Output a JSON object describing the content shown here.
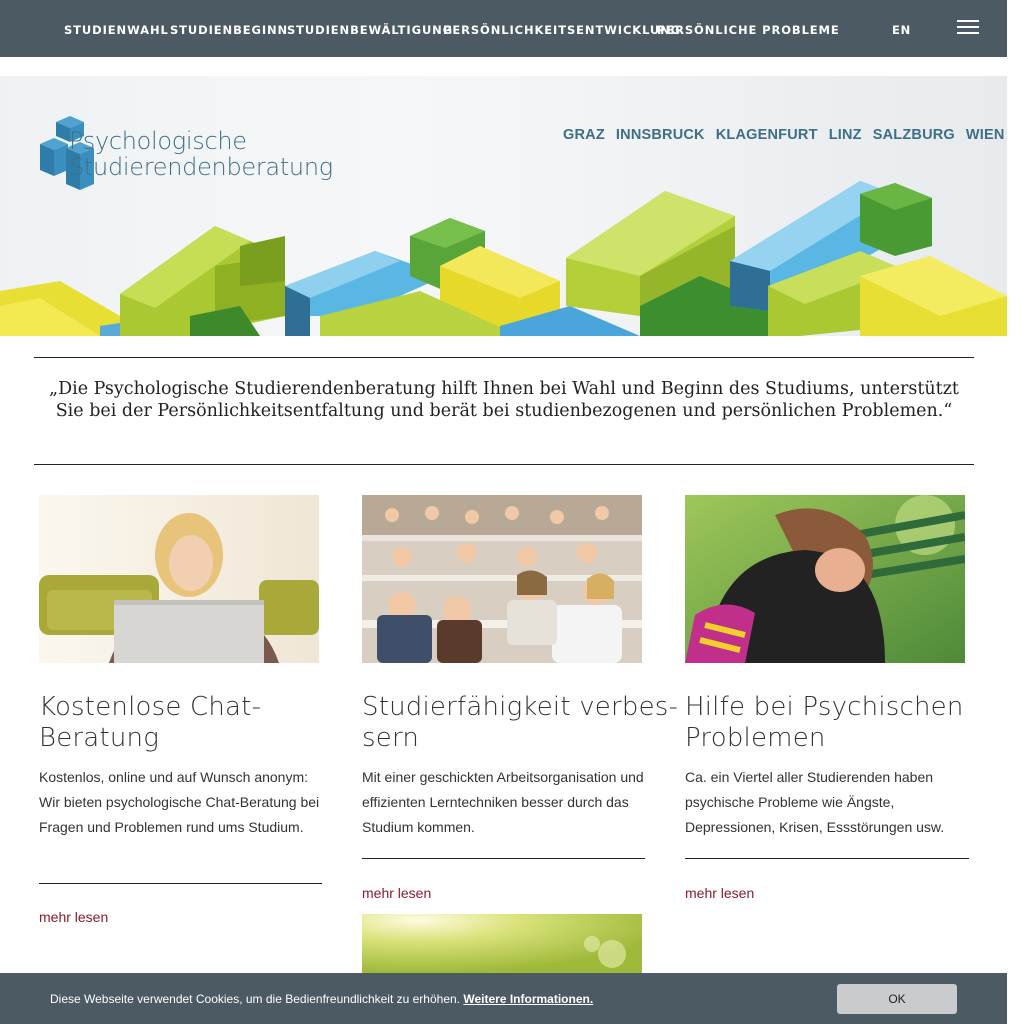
{
  "nav": {
    "items": [
      {
        "label": "STUDIENWAHL"
      },
      {
        "label": "STUDIENBEGINN"
      },
      {
        "label": "STUDIENBEWÄLTIGUNG"
      },
      {
        "label": "PERSÖNLICHKEITSENTWICKLUNG"
      },
      {
        "label": "PERSÖNLICHE PROBLEME"
      }
    ],
    "lang": "EN",
    "menu_icon": "hamburger-icon"
  },
  "header": {
    "logo_line1": "Psychologische",
    "logo_line2": "Studierendenberatung",
    "cities": [
      "GRAZ",
      "INNSBRUCK",
      "KLAGENFURT",
      "LINZ",
      "SALZBURG",
      "WIEN"
    ]
  },
  "quote": "„Die Psychologische Studierendenberatung hilft Ihnen bei Wahl und Beginn des Studiums, unterstützt Sie bei der Persönlichkeitsentfaltung und berät bei studienbezogenen und persönlichen Problemen.“",
  "cards": [
    {
      "title_line1": "Kostenlose Chat-",
      "title_line2": "Beratung",
      "text": "Kostenlos, online und auf Wunsch anonym: Wir bieten psychologische Chat-Beratung bei Fragen und Problemen rund ums Studium.",
      "more": "mehr lesen"
    },
    {
      "title_line1": "Studierfähigkeit verbes-",
      "title_line2": "sern",
      "text": "Mit einer geschickten Arbeitsorganisation und effizienten Lerntechniken besser durch das Studium kommen.",
      "more": "mehr lesen"
    },
    {
      "title_line1": "Hilfe bei Psychischen",
      "title_line2": "Problemen",
      "text": "Ca. ein Viertel aller Studierenden haben psychische Probleme wie Ängste, Depressionen, Krisen, Essstörungen usw.",
      "more": "mehr lesen"
    }
  ],
  "cookie": {
    "text": "Diese Webseite verwendet Cookies, um die Bedienfreundlichkeit zu erhöhen.",
    "link": "Weitere Informationen.",
    "ok": "OK"
  },
  "colors": {
    "nav_bg": "#4c5a64",
    "brand_blue": "#3e6f87",
    "link_red": "#8a1c2c"
  }
}
